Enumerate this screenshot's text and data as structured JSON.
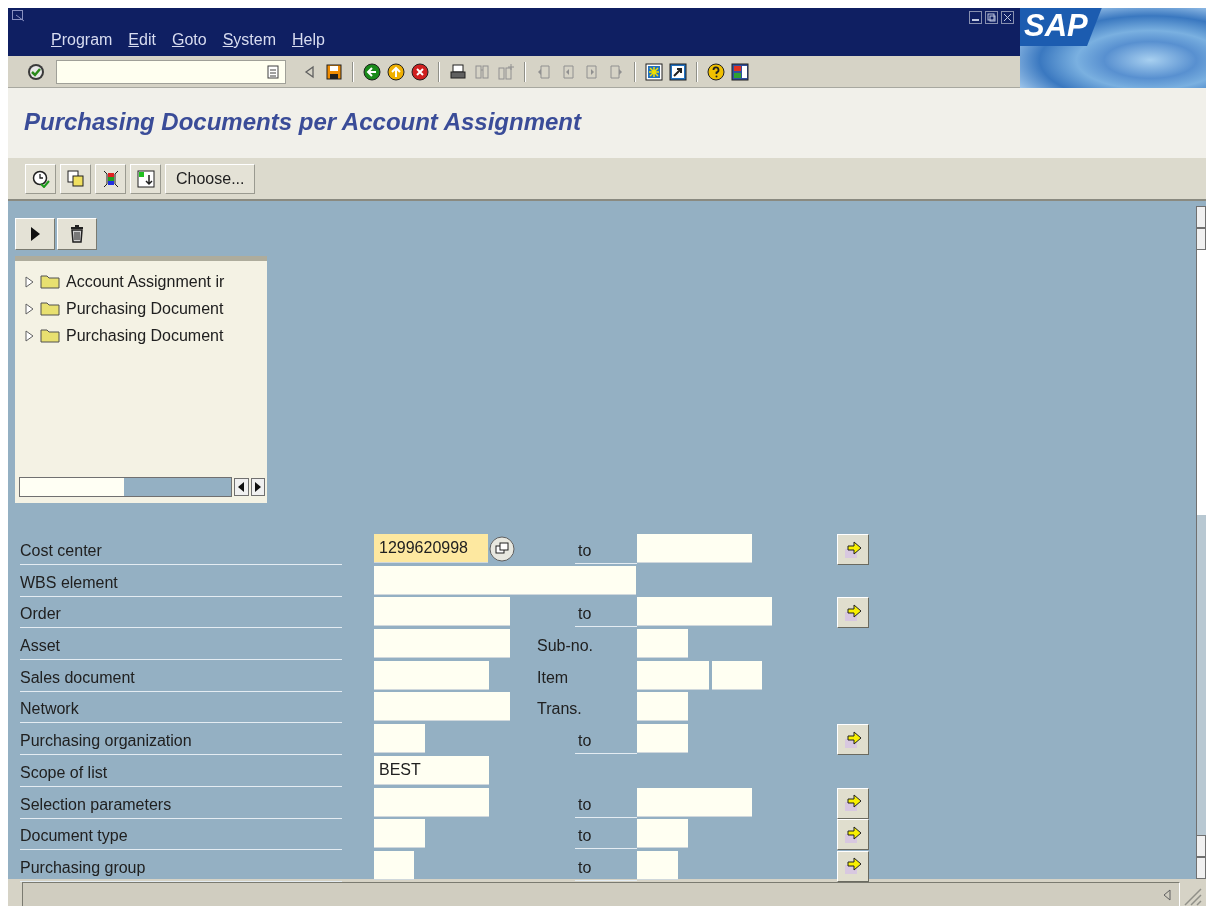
{
  "window": {
    "logo": "SAP",
    "controls": [
      {
        "kind": "minimize"
      },
      {
        "kind": "maximize"
      },
      {
        "kind": "close"
      }
    ]
  },
  "menu": [
    {
      "label": "Program"
    },
    {
      "label": "Edit"
    },
    {
      "label": "Goto"
    },
    {
      "label": "System"
    },
    {
      "label": "Help"
    }
  ],
  "toolbar": {
    "groups": [
      [
        {
          "kind": "enter",
          "disabled": false
        }
      ],
      [
        {
          "kind": "previous",
          "disabled": false
        },
        {
          "kind": "save",
          "disabled": false
        }
      ],
      [
        {
          "kind": "back",
          "disabled": false
        },
        {
          "kind": "exit",
          "disabled": false
        },
        {
          "kind": "cancel",
          "disabled": false
        }
      ],
      [
        {
          "kind": "print",
          "disabled": false
        },
        {
          "kind": "find",
          "disabled": true
        },
        {
          "kind": "find_next",
          "disabled": true
        }
      ],
      [
        {
          "kind": "first_page",
          "disabled": true
        },
        {
          "kind": "previous_page",
          "disabled": true
        },
        {
          "kind": "next_page",
          "disabled": true
        },
        {
          "kind": "last_page",
          "disabled": true
        }
      ],
      [
        {
          "kind": "new_session",
          "disabled": false
        },
        {
          "kind": "shortcut",
          "disabled": false
        }
      ],
      [
        {
          "kind": "help",
          "disabled": false
        },
        {
          "kind": "customize",
          "disabled": false
        }
      ]
    ]
  },
  "title": "Purchasing Documents per Account Assignment",
  "app_toolbar": [
    {
      "kind": "execute"
    },
    {
      "kind": "variants"
    },
    {
      "kind": "layout"
    },
    {
      "kind": "import"
    },
    {
      "kind": "text",
      "label": "Choose..."
    }
  ],
  "tree_toolbar": [
    {
      "kind": "expand"
    },
    {
      "kind": "delete"
    }
  ],
  "tree": [
    {
      "label": "Account Assignment ir",
      "expanded": false
    },
    {
      "label": "Purchasing Document",
      "expanded": false
    },
    {
      "label": "Purchasing Document",
      "expanded": false
    }
  ],
  "form": [
    {
      "label": "Cost center",
      "low": {
        "value": "1299620998",
        "focused": true,
        "value_help": true
      },
      "mid": {
        "kind": "to",
        "text": "to"
      },
      "high": [
        {
          "focused": false
        }
      ],
      "multi_selection": true
    },
    {
      "label": "WBS element",
      "low": {
        "focused": false,
        "value_help": false
      },
      "multi_selection": false
    },
    {
      "label": "Order",
      "low": {
        "focused": false,
        "value_help": false
      },
      "mid": {
        "kind": "to",
        "text": "to"
      },
      "high": [
        {
          "focused": false
        }
      ],
      "multi_selection": true
    },
    {
      "label": "Asset",
      "low": {
        "focused": false,
        "value_help": false
      },
      "mid": {
        "kind": "label",
        "text": "Sub-no."
      },
      "high": [
        {
          "focused": false
        }
      ],
      "multi_selection": false
    },
    {
      "label": "Sales document",
      "low": {
        "focused": false,
        "value_help": false
      },
      "mid": {
        "kind": "label",
        "text": "Item"
      },
      "high": [
        {
          "focused": false
        },
        {
          "focused": false
        }
      ],
      "multi_selection": false
    },
    {
      "label": "Network",
      "low": {
        "focused": false,
        "value_help": false
      },
      "mid": {
        "kind": "label",
        "text": "Trans."
      },
      "high": [
        {
          "focused": false
        }
      ],
      "multi_selection": false
    },
    {
      "label": "Purchasing organization",
      "low": {
        "focused": false,
        "value_help": false
      },
      "mid": {
        "kind": "to",
        "text": "to"
      },
      "high": [
        {
          "focused": false
        }
      ],
      "multi_selection": true
    },
    {
      "label": "Scope of list",
      "low": {
        "value": "BEST",
        "focused": false,
        "value_help": false
      },
      "multi_selection": false
    },
    {
      "label": "Selection parameters",
      "low": {
        "focused": false,
        "value_help": false
      },
      "mid": {
        "kind": "to",
        "text": "to"
      },
      "high": [
        {
          "focused": false
        }
      ],
      "multi_selection": true
    },
    {
      "label": "Document type",
      "low": {
        "focused": false,
        "value_help": false
      },
      "mid": {
        "kind": "to",
        "text": "to"
      },
      "high": [
        {
          "focused": false
        }
      ],
      "multi_selection": true
    },
    {
      "label": "Purchasing group",
      "low": {
        "focused": false,
        "value_help": false
      },
      "mid": {
        "kind": "to",
        "text": "to"
      },
      "high": [
        {
          "focused": false
        }
      ],
      "multi_selection": true
    }
  ]
}
